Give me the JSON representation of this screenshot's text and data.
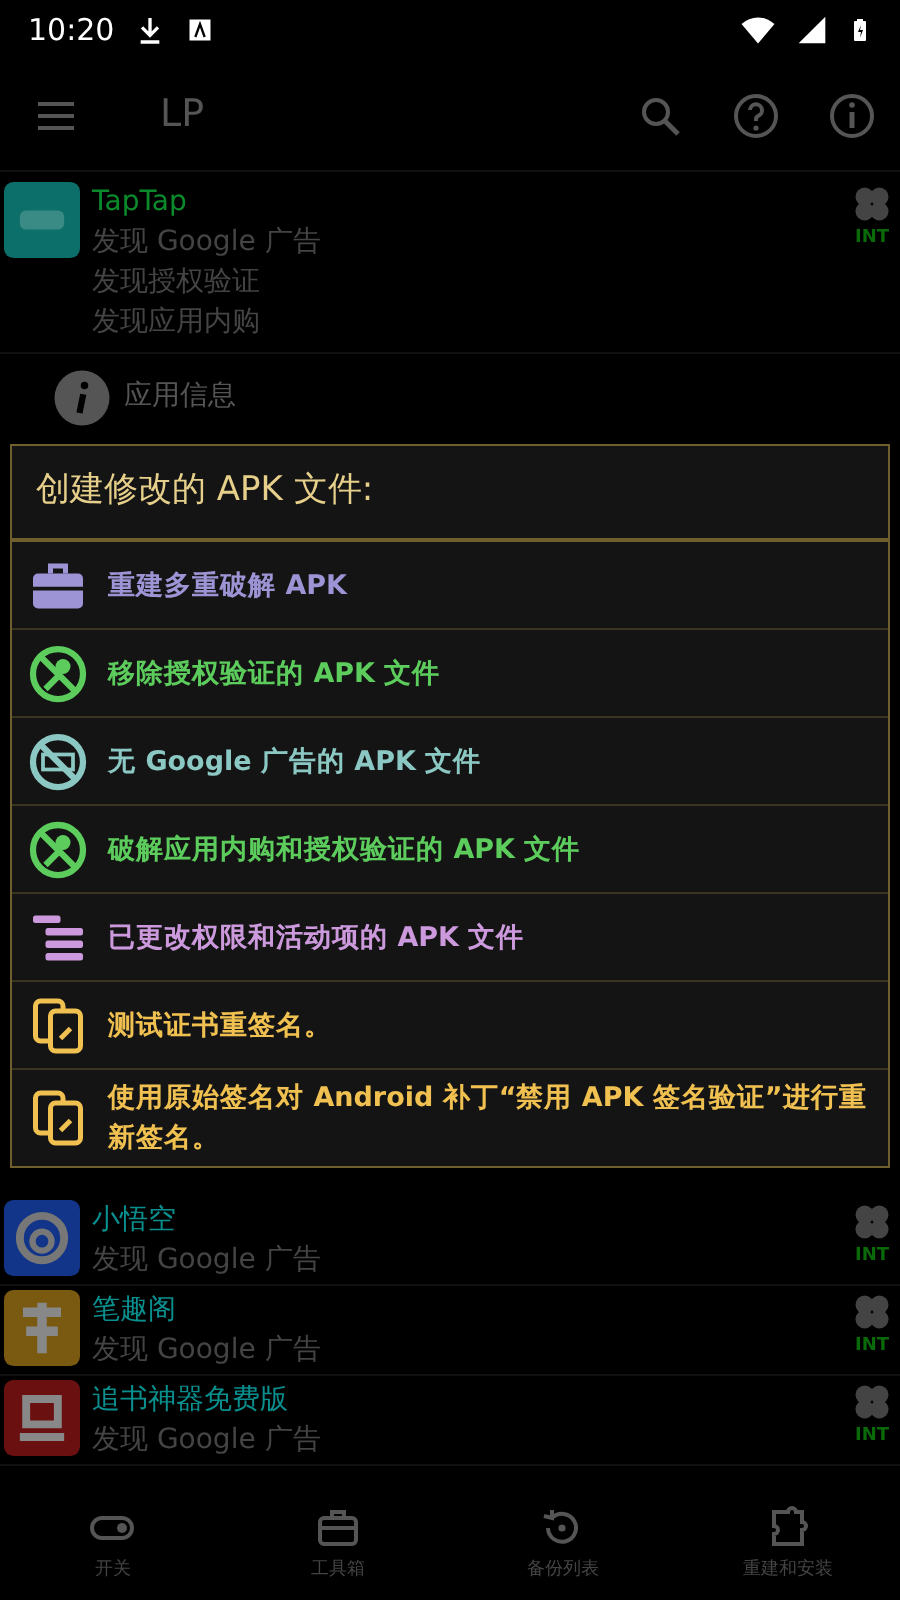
{
  "status_bar": {
    "time": "10:20"
  },
  "app_bar": {
    "title": "LP"
  },
  "apps_top": [
    {
      "name": "TapTap",
      "color": "#0a8a2a",
      "kind": "tap",
      "findings": [
        "发现 Google 广告",
        "发现授权验证",
        "发现应用内购"
      ],
      "badge": "INT"
    }
  ],
  "app_info": {
    "label": "应用信息"
  },
  "apps": [
    {
      "name": "小悟空",
      "color": "#0a8f8f",
      "kind": "swirl",
      "findings": [
        "发现 Google 广告"
      ],
      "badge": "INT"
    },
    {
      "name": "笔趣阁",
      "color": "#0a8f8f",
      "kind": "brush",
      "findings": [
        "发现 Google 广告"
      ],
      "badge": "INT"
    },
    {
      "name": "追书神器免费版",
      "color": "#0a8f8f",
      "kind": "book",
      "findings": [
        "发现 Google 广告"
      ],
      "badge": "INT"
    }
  ],
  "dialog": {
    "title": "创建修改的 APK 文件:",
    "options": [
      {
        "label": "重建多重破解 APK",
        "kind": "toolbox"
      },
      {
        "label": "移除授权验证的 APK 文件",
        "kind": "nolicense"
      },
      {
        "label": "无 Google 广告的 APK 文件",
        "kind": "noads"
      },
      {
        "label": "破解应用内购和授权验证的 APK 文件",
        "kind": "nolicense"
      },
      {
        "label": "已更改权限和活动项的 APK 文件",
        "kind": "permissions"
      },
      {
        "label": "测试证书重签名。",
        "kind": "certificate"
      },
      {
        "label": "使用原始签名对 Android 补丁“禁用 APK 签名验证”进行重新签名。",
        "kind": "certificate"
      }
    ]
  },
  "bottom_nav": [
    {
      "label": "开关",
      "kind": "toggle"
    },
    {
      "label": "工具箱",
      "kind": "toolbox"
    },
    {
      "label": "备份列表",
      "kind": "restore"
    },
    {
      "label": "重建和安装",
      "kind": "puzzle"
    }
  ]
}
